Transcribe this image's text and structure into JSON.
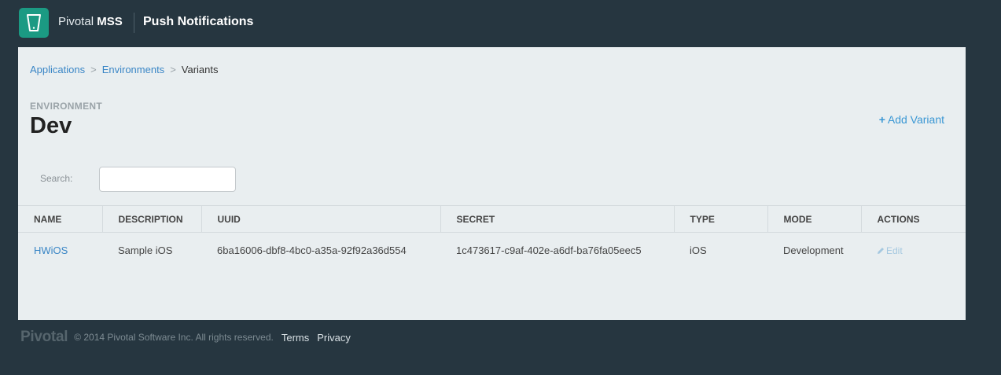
{
  "header": {
    "brand_prefix": "Pivotal",
    "brand_strong": "MSS",
    "product": "Push Notifications",
    "logo_icon": "mobile-device-icon",
    "accent_color": "#1b9a83"
  },
  "breadcrumb": {
    "items": [
      "Applications",
      "Environments",
      "Variants"
    ],
    "separator": ">"
  },
  "environment": {
    "label": "ENVIRONMENT",
    "name": "Dev"
  },
  "actions": {
    "add_variant_icon": "+",
    "add_variant_label": "Add Variant"
  },
  "search": {
    "label": "Search:",
    "value": "",
    "placeholder": ""
  },
  "table": {
    "columns": [
      "NAME",
      "DESCRIPTION",
      "UUID",
      "SECRET",
      "TYPE",
      "MODE",
      "ACTIONS"
    ],
    "rows": [
      {
        "name": "HWiOS",
        "description": "Sample iOS",
        "uuid": "6ba16006-dbf8-4bc0-a35a-92f92a36d554",
        "secret": "1c473617-c9af-402e-a6df-ba76fa05eec5",
        "type": "iOS",
        "mode": "Development",
        "action_label": "Edit",
        "action_icon": "pencil-icon"
      }
    ]
  },
  "footer": {
    "logo": "Pivotal",
    "copyright": "© 2014 Pivotal Software Inc. All rights reserved.",
    "links": [
      "Terms",
      "Privacy"
    ]
  }
}
